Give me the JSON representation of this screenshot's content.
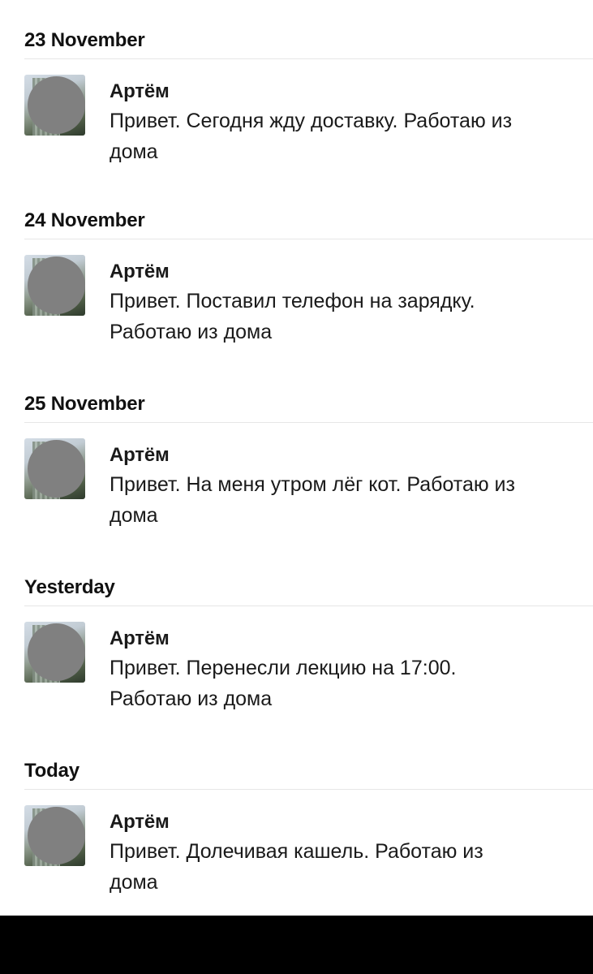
{
  "groups": [
    {
      "date": "23 November",
      "message": {
        "sender": "Артём",
        "text": "Привет. Сегодня жду доставку. Работаю из дома"
      }
    },
    {
      "date": "24 November",
      "message": {
        "sender": "Артём",
        "text": "Привет. Поставил телефон на зарядку. Работаю из дома"
      }
    },
    {
      "date": "25 November",
      "message": {
        "sender": "Артём",
        "text": "Привет. На меня утром лёг кот. Работаю из дома"
      }
    },
    {
      "date": "Yesterday",
      "message": {
        "sender": "Артём",
        "text": "Привет. Перенесли лекцию на 17:00. Работаю из дома"
      }
    },
    {
      "date": "Today",
      "message": {
        "sender": "Артём",
        "text": "Привет. Долечивая кашель. Работаю из дома"
      }
    }
  ]
}
